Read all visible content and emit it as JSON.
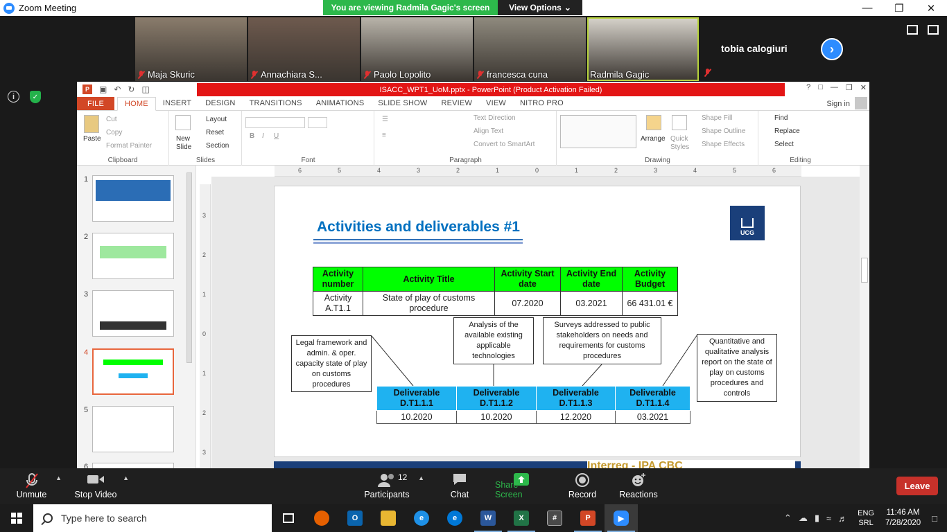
{
  "zoom": {
    "window_title": "Zoom Meeting",
    "viewing_banner": "You are viewing Radmila Gagic's screen",
    "view_options": "View Options",
    "participants": [
      {
        "name": "Maja Skuric",
        "bg": "#8a7c6c"
      },
      {
        "name": "Annachiara S...",
        "bg": "#6e5a4e"
      },
      {
        "name": "Paolo Lopolito",
        "bg": "#b9b4aa"
      },
      {
        "name": "francesca cuna",
        "bg": "#8f8a7e"
      },
      {
        "name": "Radmila Gagic",
        "bg": "#d8d4cc"
      }
    ],
    "extra_participant": "tobia calogiuri",
    "toolbar": {
      "unmute": "Unmute",
      "stop_video": "Stop Video",
      "participants_label": "Participants",
      "participants_count": "12",
      "chat": "Chat",
      "share_screen": "Share Screen",
      "record": "Record",
      "reactions": "Reactions",
      "leave": "Leave"
    }
  },
  "ppt": {
    "title": "ISACC_WPT1_UoM.pptx - PowerPoint (Product Activation Failed)",
    "tabs": [
      "FILE",
      "HOME",
      "INSERT",
      "DESIGN",
      "TRANSITIONS",
      "ANIMATIONS",
      "SLIDE SHOW",
      "REVIEW",
      "VIEW",
      "NITRO PRO"
    ],
    "sign_in": "Sign in",
    "ribbon": {
      "clipboard": {
        "label": "Clipboard",
        "paste": "Paste",
        "cut": "Cut",
        "copy": "Copy",
        "format_painter": "Format Painter"
      },
      "slides": {
        "label": "Slides",
        "new_slide": "New Slide",
        "layout": "Layout",
        "reset": "Reset",
        "section": "Section"
      },
      "font": {
        "label": "Font"
      },
      "paragraph": {
        "label": "Paragraph",
        "text_direction": "Text Direction",
        "align_text": "Align Text",
        "convert_smartart": "Convert to SmartArt"
      },
      "drawing": {
        "label": "Drawing",
        "arrange": "Arrange",
        "quick_styles": "Quick Styles",
        "shape_fill": "Shape Fill",
        "shape_outline": "Shape Outline",
        "shape_effects": "Shape Effects"
      },
      "editing": {
        "label": "Editing",
        "find": "Find",
        "replace": "Replace",
        "select": "Select"
      }
    },
    "thumbnails": [
      "1",
      "2",
      "3",
      "4",
      "5",
      "6"
    ],
    "selected_slide": "4",
    "ruler_h": [
      "6",
      "5",
      "4",
      "3",
      "2",
      "1",
      "0",
      "1",
      "2",
      "3",
      "4",
      "5",
      "6"
    ],
    "ruler_v": [
      "3",
      "2",
      "1",
      "0",
      "1",
      "2",
      "3"
    ]
  },
  "slide": {
    "title": "Activities and deliverables #1",
    "logo_text": "UCG",
    "activity_table": {
      "headers": [
        "Activity number",
        "Activity Title",
        "Activity Start date",
        "Activity End date",
        "Activity Budget"
      ],
      "row": [
        "Activity A.T1.1",
        "State of play of customs procedure",
        "07.2020",
        "03.2021",
        "66 431.01 €"
      ]
    },
    "boxes": [
      "Legal framework and admin. & oper. capacity state of play on customs procedures",
      "Analysis of the available existing applicable technologies",
      "Surveys addressed to public stakeholders on needs and requirements for customs procedures",
      "Quantitative and qualitative analysis report on the state of play on customs procedures and controls"
    ],
    "deliverable_table": {
      "headers": [
        "Deliverable D.T1.1.1",
        "Deliverable D.T1.1.2",
        "Deliverable D.T1.1.3",
        "Deliverable D.T1.1.4"
      ],
      "dates": [
        "10.2020",
        "10.2020",
        "12.2020",
        "03.2021"
      ]
    },
    "footer_brand": "Interreg - IPA CBC"
  },
  "taskbar": {
    "search_placeholder": "Type here to search",
    "lang_top": "ENG",
    "lang_bottom": "SRL",
    "time": "11:46 AM",
    "date": "7/28/2020"
  }
}
